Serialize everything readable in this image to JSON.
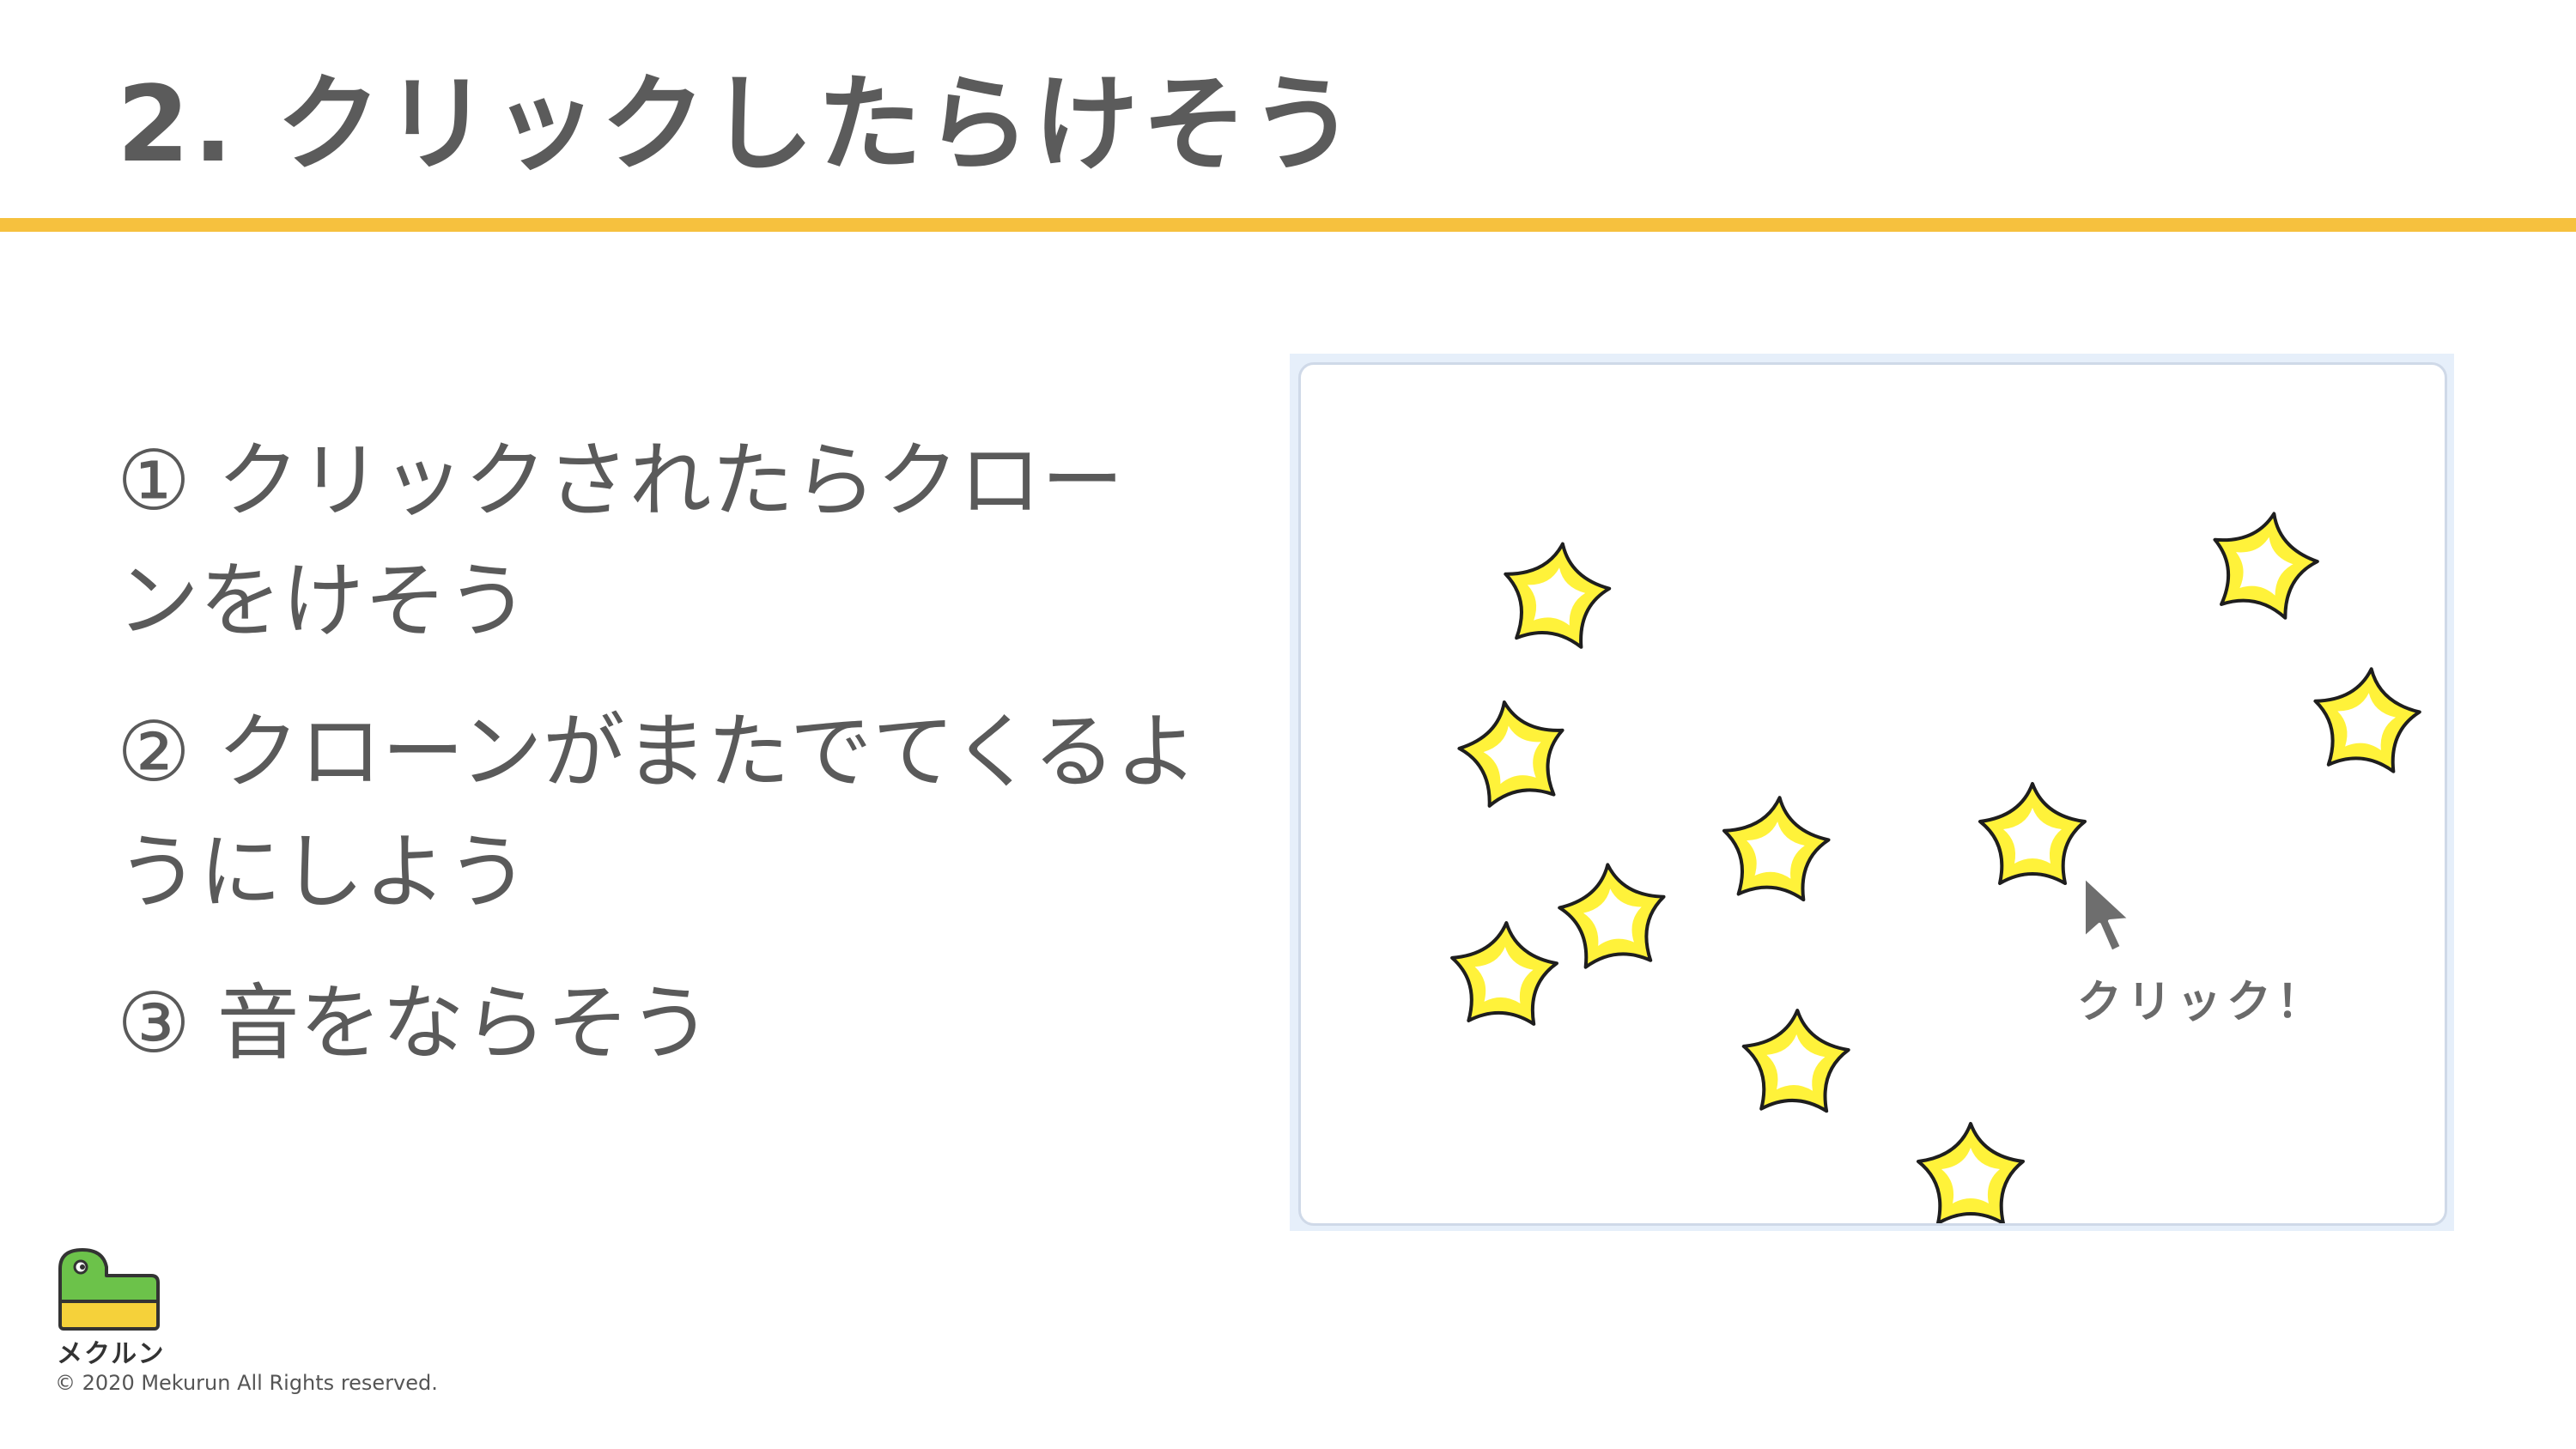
{
  "slide": {
    "title": "2. クリックしたらけそう",
    "accent_color": "#f6c13e"
  },
  "steps": [
    {
      "text": "① クリックされたらクローンをけそう"
    },
    {
      "text": "② クローンがまたでてくるようにしよう"
    },
    {
      "text": "③ 音をならそう"
    }
  ],
  "stage": {
    "sprite_icon": "star-icon",
    "star_fill": "#fff23a",
    "star_outline": "#1e1e1e",
    "cursor_icon": "mouse-pointer-icon",
    "click_label": "クリック！"
  },
  "footer": {
    "logo_icon": "mekurun-dinosaur-logo",
    "logo_text": "メクルン",
    "copyright": "© 2020 Mekurun All Rights reserved."
  }
}
